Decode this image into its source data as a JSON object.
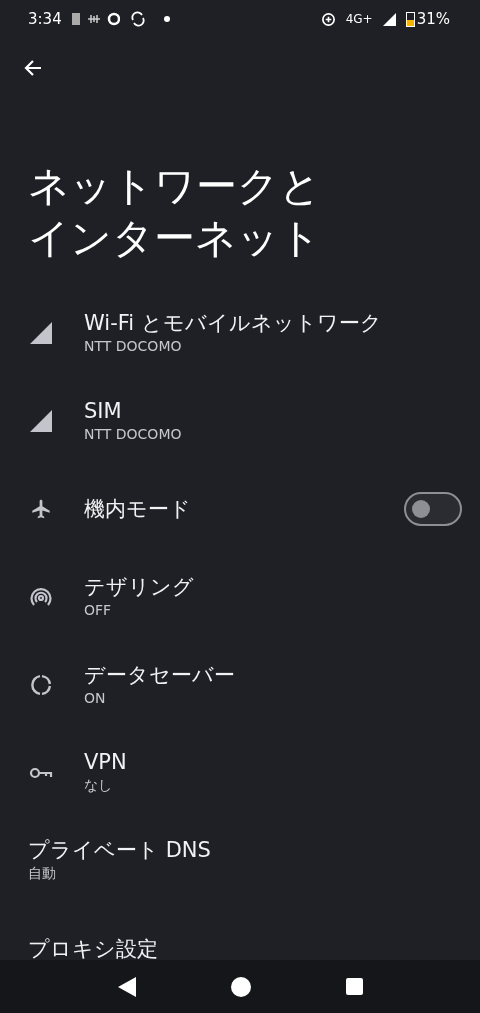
{
  "status_bar": {
    "time": "3:34",
    "network": "4G+",
    "battery": "31%"
  },
  "title_lines": [
    "ネットワークと",
    "インターネット"
  ],
  "items": [
    {
      "kind": "link",
      "title": "Wi-Fi とモバイルネットワーク",
      "summary": "NTT DOCOMO"
    },
    {
      "kind": "link",
      "title": "SIM",
      "summary": "NTT DOCOMO"
    },
    {
      "kind": "toggle",
      "title": "機内モード",
      "on": false
    },
    {
      "kind": "link",
      "title": "テザリング",
      "summary": "OFF"
    },
    {
      "kind": "link",
      "title": "データセーバー",
      "summary": "ON"
    },
    {
      "kind": "link",
      "title": "VPN",
      "summary": "なし"
    },
    {
      "kind": "plain",
      "title": "プライベート DNS",
      "summary": "自動"
    },
    {
      "kind": "plain",
      "title": "プロキシ設定"
    }
  ]
}
